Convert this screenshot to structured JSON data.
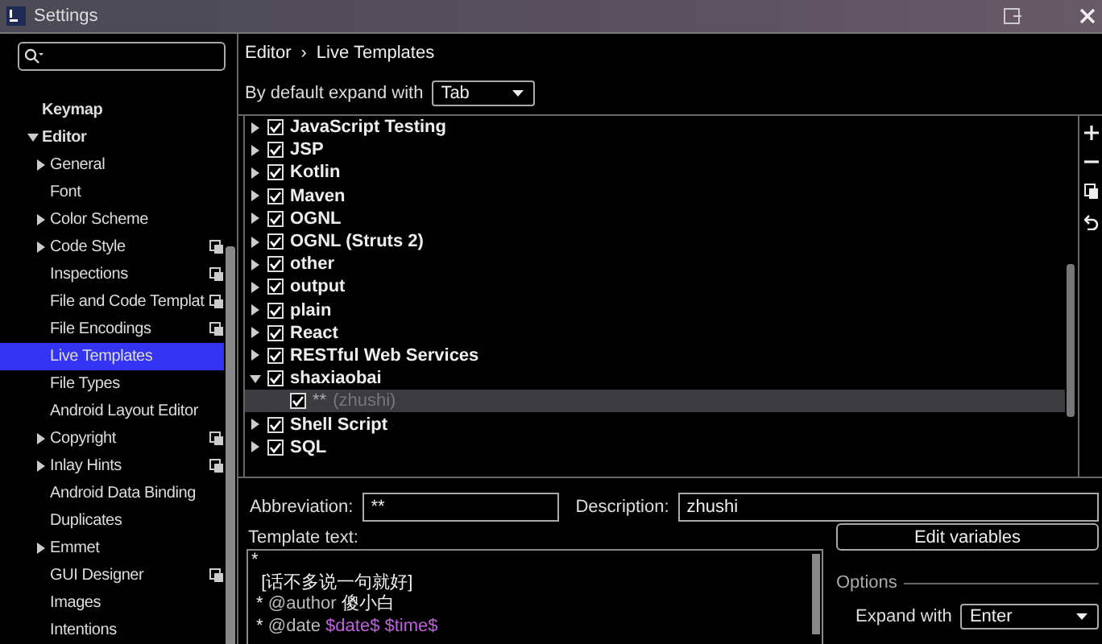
{
  "window": {
    "title": "Settings"
  },
  "sidebar": {
    "items": [
      {
        "label": "Keymap",
        "kind": "leaf",
        "project": false
      },
      {
        "label": "Editor",
        "kind": "group",
        "expanded": true,
        "project": false,
        "children": [
          {
            "label": "General",
            "kind": "group",
            "expanded": false,
            "project": false,
            "selected": false
          },
          {
            "label": "Font",
            "kind": "leaf",
            "project": false,
            "selected": false
          },
          {
            "label": "Color Scheme",
            "kind": "group",
            "expanded": false,
            "project": false,
            "selected": false
          },
          {
            "label": "Code Style",
            "kind": "group",
            "expanded": false,
            "project": true,
            "selected": false
          },
          {
            "label": "Inspections",
            "kind": "leaf",
            "project": true,
            "selected": false
          },
          {
            "label": "File and Code Templat",
            "kind": "leaf",
            "project": true,
            "selected": false
          },
          {
            "label": "File Encodings",
            "kind": "leaf",
            "project": true,
            "selected": false
          },
          {
            "label": "Live Templates",
            "kind": "leaf",
            "project": false,
            "selected": true
          },
          {
            "label": "File Types",
            "kind": "leaf",
            "project": false,
            "selected": false
          },
          {
            "label": "Android Layout Editor",
            "kind": "leaf",
            "project": false,
            "selected": false
          },
          {
            "label": "Copyright",
            "kind": "group",
            "expanded": false,
            "project": true,
            "selected": false
          },
          {
            "label": "Inlay Hints",
            "kind": "group",
            "expanded": false,
            "project": true,
            "selected": false
          },
          {
            "label": "Android Data Binding",
            "kind": "leaf",
            "project": false,
            "selected": false
          },
          {
            "label": "Duplicates",
            "kind": "leaf",
            "project": false,
            "selected": false
          },
          {
            "label": "Emmet",
            "kind": "group",
            "expanded": false,
            "project": false,
            "selected": false
          },
          {
            "label": "GUI Designer",
            "kind": "leaf",
            "project": true,
            "selected": false
          },
          {
            "label": "Images",
            "kind": "leaf",
            "project": false,
            "selected": false
          },
          {
            "label": "Intentions",
            "kind": "leaf",
            "project": false,
            "selected": false
          }
        ]
      }
    ]
  },
  "breadcrumb": [
    "Editor",
    "›",
    "Live Templates"
  ],
  "expand_default": {
    "label": "By default expand with",
    "value": "Tab"
  },
  "templates": [
    {
      "label": "JavaScript Testing",
      "checked": true,
      "expanded": false
    },
    {
      "label": "JSP",
      "checked": true,
      "expanded": false
    },
    {
      "label": "Kotlin",
      "checked": true,
      "expanded": false
    },
    {
      "label": "Maven",
      "checked": true,
      "expanded": false
    },
    {
      "label": "OGNL",
      "checked": true,
      "expanded": false
    },
    {
      "label": "OGNL (Struts 2)",
      "checked": true,
      "expanded": false
    },
    {
      "label": "other",
      "checked": true,
      "expanded": false
    },
    {
      "label": "output",
      "checked": true,
      "expanded": false
    },
    {
      "label": "plain",
      "checked": true,
      "expanded": false
    },
    {
      "label": "React",
      "checked": true,
      "expanded": false
    },
    {
      "label": "RESTful Web Services",
      "checked": true,
      "expanded": false
    },
    {
      "label": "shaxiaobai",
      "checked": true,
      "expanded": true,
      "children": [
        {
          "label": "**",
          "description": "(zhushi)",
          "checked": true,
          "selected": true
        }
      ]
    },
    {
      "label": "Shell Script",
      "checked": true,
      "expanded": false
    },
    {
      "label": "SQL",
      "checked": true,
      "expanded": false
    }
  ],
  "abbreviation": {
    "label": "Abbreviation:",
    "value": "**"
  },
  "description": {
    "label": "Description:",
    "value": "zhushi"
  },
  "template_text": {
    "label": "Template text:",
    "lines": [
      [
        {
          "kind": "plain",
          "text": "*"
        }
      ],
      [
        {
          "kind": "plain",
          "text": "  [话不多说一句就好]"
        }
      ],
      [
        {
          "kind": "plain",
          "text": " * "
        },
        {
          "kind": "tag",
          "text": "@author"
        },
        {
          "kind": "plain",
          "text": " 傻小白"
        }
      ],
      [
        {
          "kind": "plain",
          "text": " * "
        },
        {
          "kind": "tag",
          "text": "@date"
        },
        {
          "kind": "var",
          "text": " $date$"
        },
        {
          "kind": "var",
          "text": " $time$"
        }
      ]
    ]
  },
  "edit_variables_button": "Edit variables",
  "options": {
    "title": "Options",
    "expand_label": "Expand with",
    "expand_value": "Enter"
  }
}
